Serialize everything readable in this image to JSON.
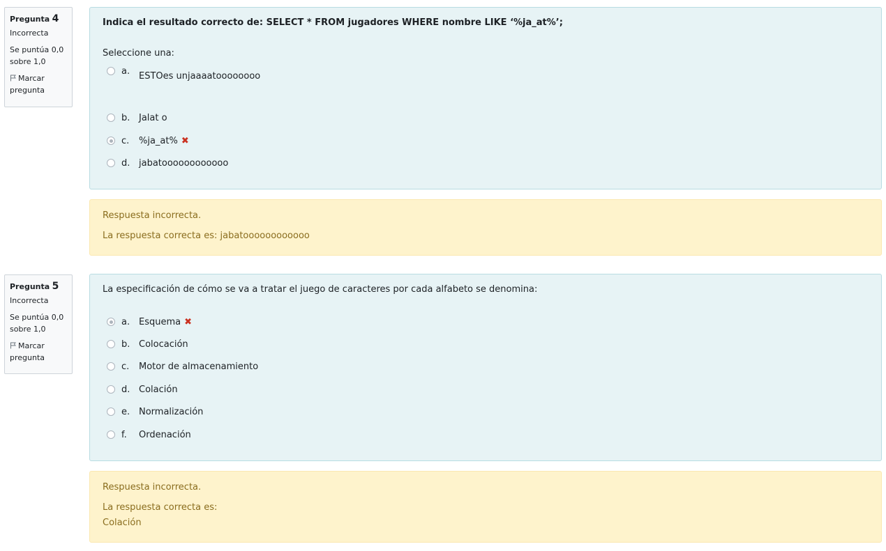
{
  "q4": {
    "info": {
      "label": "Pregunta",
      "number": "4",
      "state": "Incorrecta",
      "grade_line1": "Se puntúa 0,0",
      "grade_line2": "sobre 1,0",
      "flag_line1": "Marcar",
      "flag_line2": "pregunta"
    },
    "question": "Indica el resultado correcto de: SELECT * FROM jugadores WHERE nombre LIKE ‘%ja_at%’;",
    "prompt": "Seleccione una:",
    "options": [
      {
        "letter": "a.",
        "text": "ESTOes unjaaaatoooooooo"
      },
      {
        "letter": "b.",
        "text": "Jalat o"
      },
      {
        "letter": "c.",
        "text": "%ja_at%"
      },
      {
        "letter": "d.",
        "text": "jabatoooooooooooo"
      }
    ],
    "selected": "c",
    "feedback": {
      "status": "Respuesta incorrecta.",
      "correct": "La respuesta correcta es: jabatoooooooooooo"
    }
  },
  "q5": {
    "info": {
      "label": "Pregunta",
      "number": "5",
      "state": "Incorrecta",
      "grade_line1": "Se puntúa 0,0",
      "grade_line2": "sobre 1,0",
      "flag_line1": "Marcar",
      "flag_line2": "pregunta"
    },
    "question": "La especificación de cómo se va a tratar el juego de caracteres por cada alfabeto se denomina:",
    "options": [
      {
        "letter": "a.",
        "text": "Esquema"
      },
      {
        "letter": "b.",
        "text": "Colocación"
      },
      {
        "letter": "c.",
        "text": "Motor de almacenamiento"
      },
      {
        "letter": "d.",
        "text": "Colación"
      },
      {
        "letter": "e.",
        "text": "Normalización"
      },
      {
        "letter": "f.",
        "text": "Ordenación"
      }
    ],
    "selected": "a",
    "feedback": {
      "status": "Respuesta incorrecta.",
      "correct_label": "La respuesta correcta es:",
      "correct_value": "Colación"
    }
  },
  "icons": {
    "flag": "flag-icon",
    "incorrect": "incorrect-x-icon"
  },
  "colors": {
    "formulation_bg": "#e7f3f5",
    "feedback_bg": "#fef3cc",
    "feedback_text": "#8a6d1e",
    "incorrect": "#ca3120"
  }
}
